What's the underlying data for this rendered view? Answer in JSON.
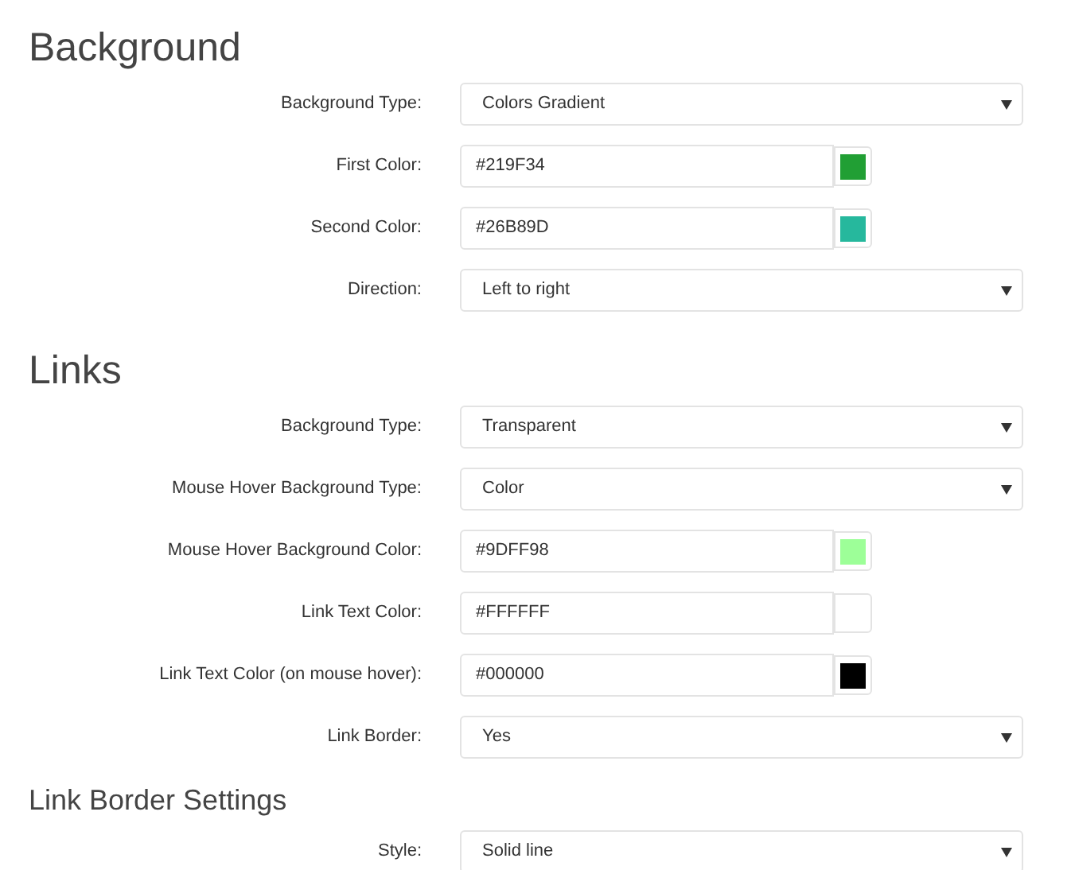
{
  "sections": [
    {
      "kind": "section",
      "title": "Background",
      "fields": [
        {
          "kind": "select",
          "label": "Background Type:",
          "value": "Colors Gradient"
        },
        {
          "kind": "color",
          "label": "First Color:",
          "value": "#219F34",
          "color": "#219f34"
        },
        {
          "kind": "color",
          "label": "Second Color:",
          "value": "#26B89D",
          "color": "#26b89d"
        },
        {
          "kind": "select",
          "label": "Direction:",
          "value": "Left to right"
        }
      ]
    },
    {
      "kind": "section",
      "title": "Links",
      "fields": [
        {
          "kind": "select",
          "label": "Background Type:",
          "value": "Transparent"
        },
        {
          "kind": "select",
          "label": "Mouse Hover Background Type:",
          "value": "Color"
        },
        {
          "kind": "color",
          "label": "Mouse Hover Background Color:",
          "value": "#9DFF98",
          "color": "#9dff98"
        },
        {
          "kind": "color",
          "label": "Link Text Color:",
          "value": "#FFFFFF",
          "color": "#ffffff"
        },
        {
          "kind": "color",
          "label": "Link Text Color (on mouse hover):",
          "value": "#000000",
          "color": "#000000"
        },
        {
          "kind": "select",
          "label": "Link Border:",
          "value": "Yes"
        }
      ]
    },
    {
      "kind": "subsection",
      "title": "Link Border Settings",
      "fields": [
        {
          "kind": "select",
          "label": "Style:",
          "value": "Solid line"
        }
      ]
    }
  ]
}
